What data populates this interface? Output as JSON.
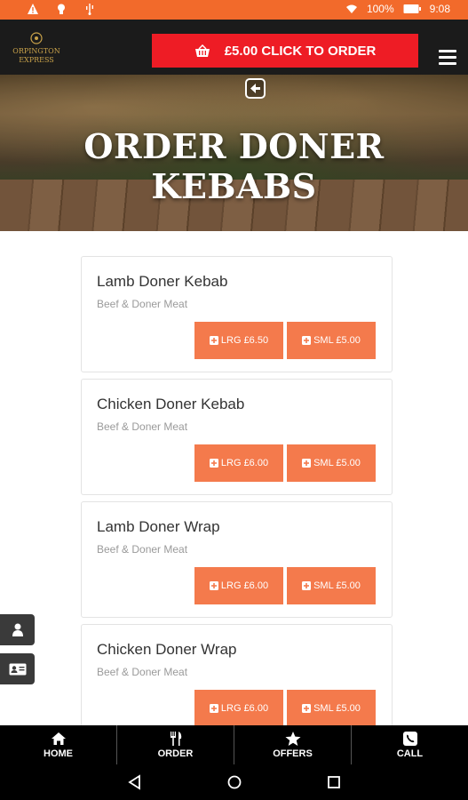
{
  "status_bar": {
    "battery": "100%",
    "time": "9:08",
    "icons": [
      "warning-icon",
      "bulb-icon",
      "usb-icon",
      "wifi-icon",
      "battery-icon"
    ]
  },
  "header": {
    "logo_line1": "ORPINGTON",
    "logo_line2": "EXPRESS",
    "order_button_label": "£5.00 CLICK TO ORDER"
  },
  "hero": {
    "title": "ORDER DONER KEBABS"
  },
  "menu_items": [
    {
      "name": "Lamb Doner Kebab",
      "desc": "Beef & Doner Meat",
      "lrg": "LRG £6.50",
      "sml": "SML £5.00"
    },
    {
      "name": "Chicken Doner Kebab",
      "desc": "Beef & Doner Meat",
      "lrg": "LRG £6.00",
      "sml": "SML £5.00"
    },
    {
      "name": "Lamb Doner Wrap",
      "desc": "Beef & Doner Meat",
      "lrg": "LRG £6.00",
      "sml": "SML £5.00"
    },
    {
      "name": "Chicken Doner Wrap",
      "desc": "Beef & Doner Meat",
      "lrg": "LRG £6.00",
      "sml": "SML £5.00"
    }
  ],
  "bottom_nav": {
    "items": [
      {
        "label": "HOME",
        "icon": "home-icon"
      },
      {
        "label": "ORDER",
        "icon": "cutlery-icon"
      },
      {
        "label": "OFFERS",
        "icon": "star-icon"
      },
      {
        "label": "CALL",
        "icon": "phone-icon"
      }
    ]
  },
  "colors": {
    "status_bar": "#f26a2b",
    "order_button": "#ee1c25",
    "price_button": "#f47a4c",
    "nav_bg": "#000000"
  }
}
